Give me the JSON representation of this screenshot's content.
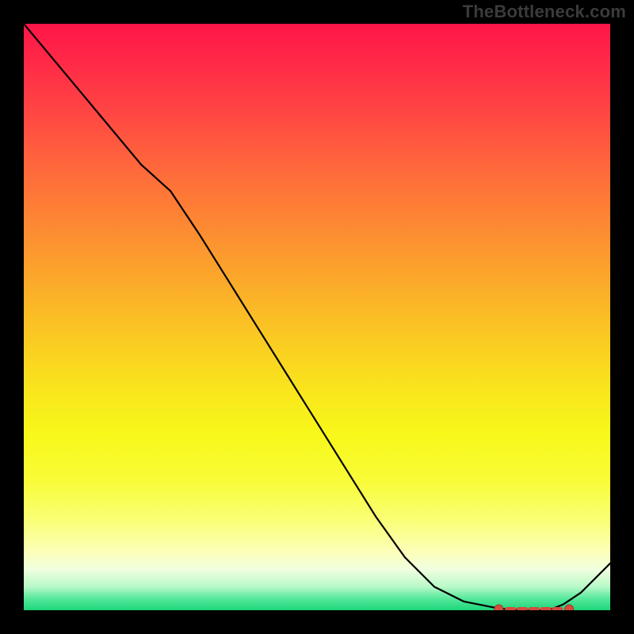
{
  "watermark": "TheBottleneck.com",
  "chart_data": {
    "type": "line",
    "title": "",
    "xlabel": "",
    "ylabel": "",
    "x": [
      0,
      0.05,
      0.1,
      0.15,
      0.2,
      0.25,
      0.3,
      0.35,
      0.4,
      0.45,
      0.5,
      0.55,
      0.6,
      0.65,
      0.7,
      0.75,
      0.8,
      0.82,
      0.85,
      0.88,
      0.9,
      0.92,
      0.95,
      1.0
    ],
    "values": [
      1.0,
      0.94,
      0.88,
      0.82,
      0.76,
      0.715,
      0.64,
      0.56,
      0.48,
      0.4,
      0.32,
      0.24,
      0.16,
      0.09,
      0.04,
      0.015,
      0.005,
      0.002,
      0.0,
      0.0,
      0.002,
      0.01,
      0.03,
      0.08
    ],
    "xlim": [
      0,
      1
    ],
    "ylim": [
      0,
      1
    ],
    "grid": false,
    "annotations": {
      "min_region_x": [
        0.81,
        0.93
      ],
      "min_region_y": 0.002,
      "marker_dots_x": [
        0.81,
        0.93
      ],
      "marker_style": "dashes_with_end_dots"
    },
    "background": "vertical_heat_gradient_red_to_green",
    "series_name": "bottleneck_curve"
  }
}
